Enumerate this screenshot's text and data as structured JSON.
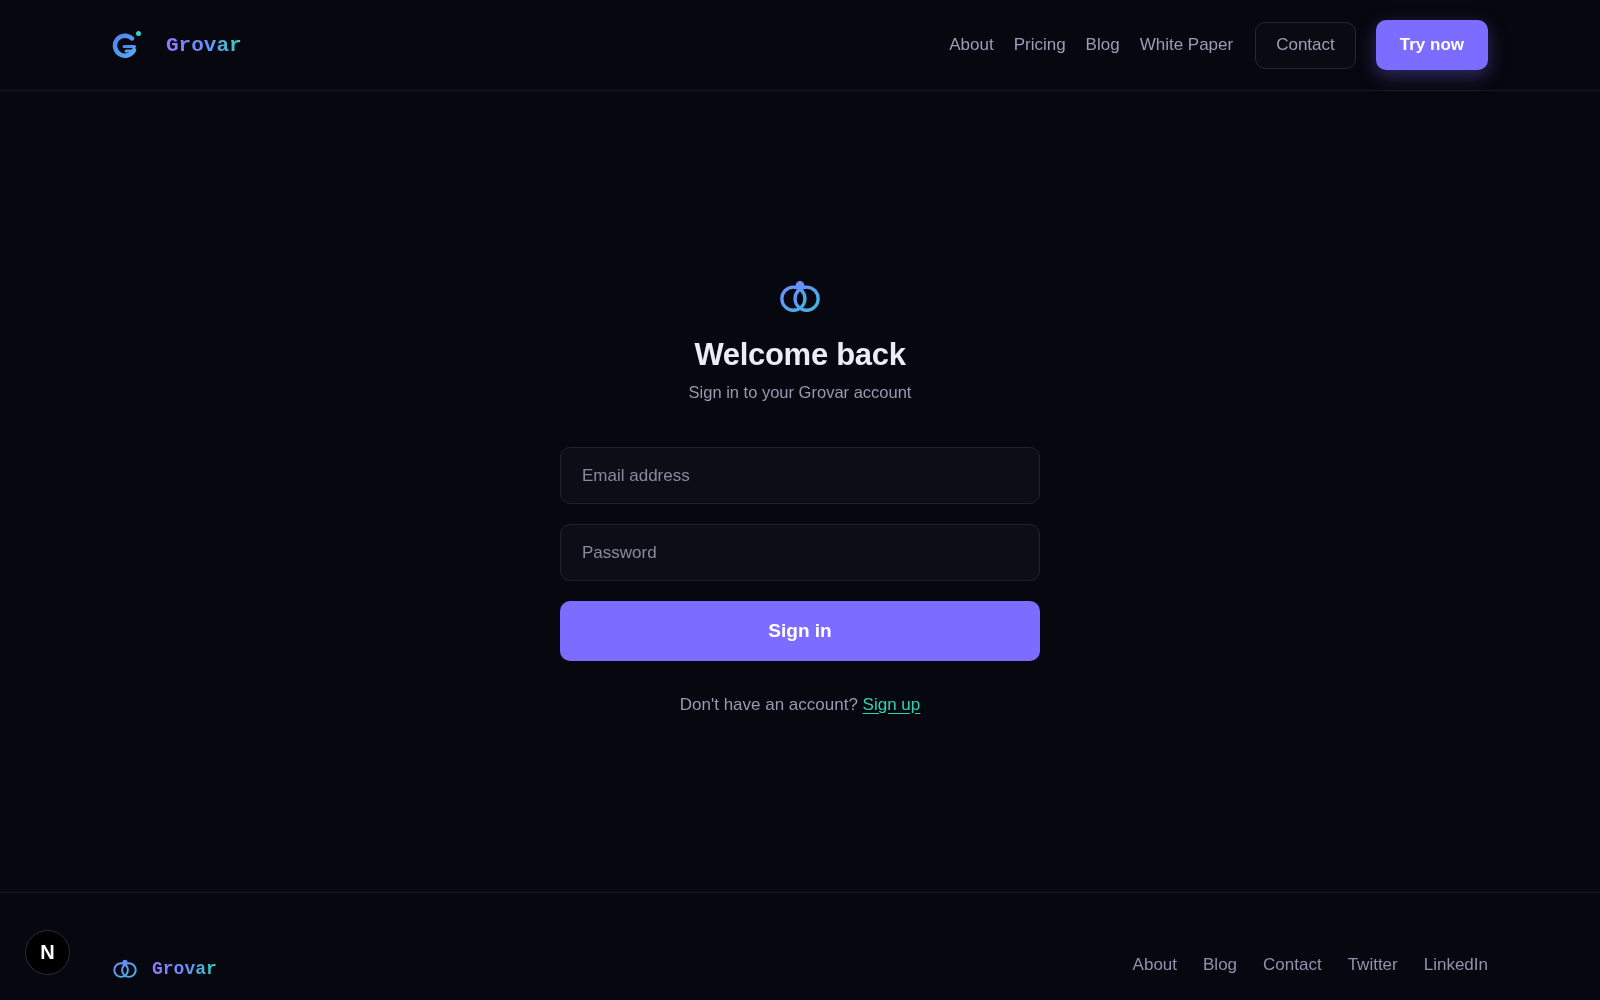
{
  "header": {
    "logo": {
      "text": "Grovar"
    },
    "nav": [
      {
        "label": "About"
      },
      {
        "label": "Pricing"
      },
      {
        "label": "Blog"
      },
      {
        "label": "White Paper"
      }
    ],
    "buttons": [
      {
        "label": "Contact",
        "kind": "outline"
      },
      {
        "label": "Try now",
        "kind": "primary"
      }
    ]
  },
  "sign_in": {
    "title": "Welcome back",
    "subtitle": "Sign in to your Grovar account",
    "fields": [
      {
        "placeholder": "Email address"
      },
      {
        "placeholder": "Password"
      }
    ],
    "submit": "Sign in",
    "prompt": "Don't have an account?",
    "link": "Sign up"
  },
  "footer": {
    "logo": {
      "text": "Grovar"
    },
    "links": [
      {
        "label": "About"
      },
      {
        "label": "Blog"
      },
      {
        "label": "Contact"
      },
      {
        "label": "Twitter"
      },
      {
        "label": "LinkedIn"
      }
    ]
  },
  "dev_badge": {
    "label": "N"
  }
}
